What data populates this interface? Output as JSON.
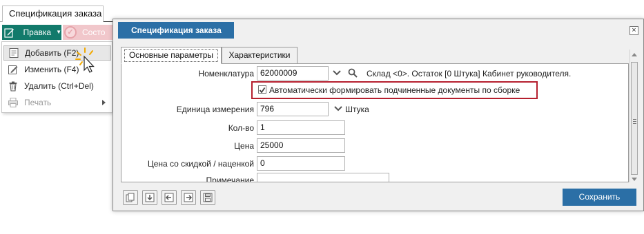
{
  "background_window": {
    "tab_title": "Спецификация заказа",
    "edit_button_label": "Правка",
    "state_button_label": "Состо"
  },
  "edit_menu": {
    "items": [
      {
        "label": "Добавить (F2)",
        "icon": "add-document-icon"
      },
      {
        "label": "Изменить (F4)",
        "icon": "pencil-icon"
      },
      {
        "label": "Удалить (Ctrl+Del)",
        "icon": "trash-icon"
      },
      {
        "label": "Печать",
        "icon": "printer-icon",
        "disabled": true,
        "has_submenu": true
      }
    ]
  },
  "dialog": {
    "title": "Спецификация заказа",
    "tabs": [
      {
        "label": "Основные параметры",
        "active": true
      },
      {
        "label": "Характеристики",
        "active": false
      }
    ],
    "form": {
      "nomenclature": {
        "label": "Номенклатура",
        "value": "62000009",
        "info": "Склад <0>. Остаток [0 Штука] Кабинет руководителя."
      },
      "auto_docs": {
        "checked": true,
        "label": "Автоматически формировать подчиненные документы по сборке"
      },
      "unit": {
        "label": "Единица измерения",
        "value": "796",
        "unit_name": "Штука"
      },
      "quantity": {
        "label": "Кол-во",
        "value": "1"
      },
      "price": {
        "label": "Цена",
        "value": "25000"
      },
      "discount_price": {
        "label": "Цена со скидкой / наценкой",
        "value": "0"
      },
      "note": {
        "label": "Примечание",
        "value": ""
      }
    },
    "save_label": "Сохранить"
  },
  "colors": {
    "accent_teal": "#127a6b",
    "accent_blue": "#2b6fa6",
    "highlight_red": "#b51f2e",
    "state_pink": "#f1c7cb"
  }
}
